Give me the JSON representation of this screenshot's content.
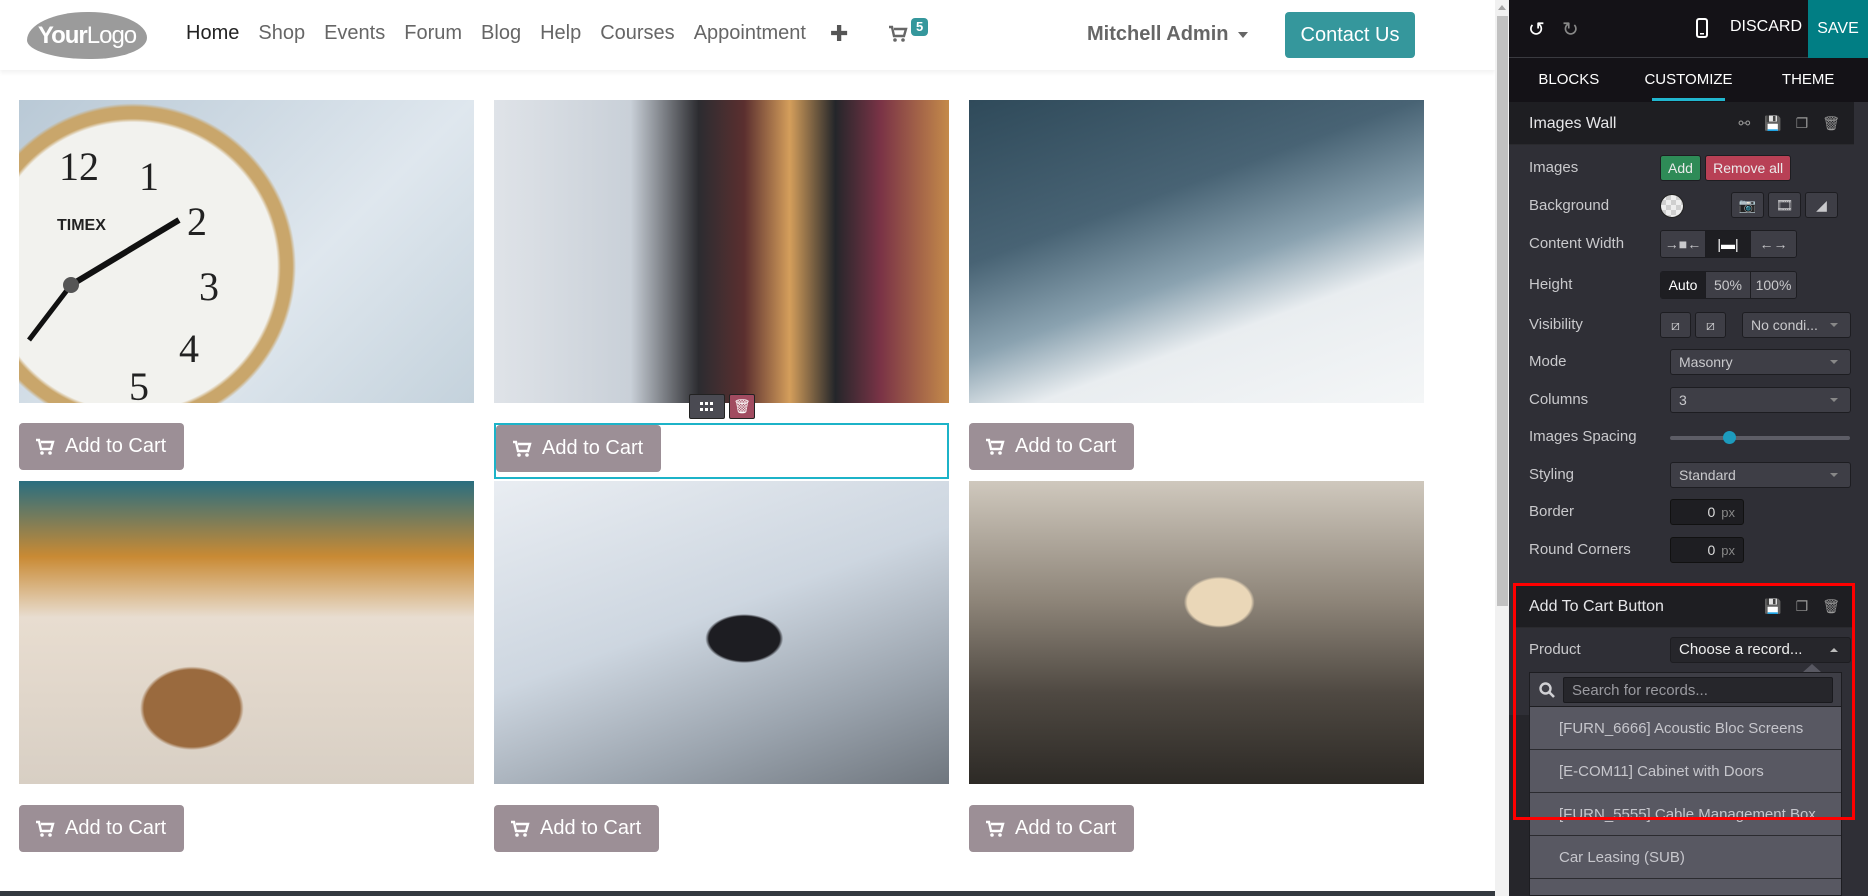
{
  "header": {
    "logo": {
      "bold": "Your",
      "light": "Logo"
    },
    "nav": [
      {
        "label": "Home",
        "active": true
      },
      {
        "label": "Shop"
      },
      {
        "label": "Events"
      },
      {
        "label": "Forum"
      },
      {
        "label": "Blog"
      },
      {
        "label": "Help"
      },
      {
        "label": "Courses"
      },
      {
        "label": "Appointment"
      }
    ],
    "add_icon": "plus-icon",
    "cart_count": "5",
    "user_name": "Mitchell Admin",
    "contact_label": "Contact Us"
  },
  "gallery": {
    "items": [
      {
        "image": "alarm-clock",
        "button": "Add to Cart"
      },
      {
        "image": "clothes-rack",
        "button": "Add to Cart",
        "selected": true
      },
      {
        "image": "man-writing",
        "button": "Add to Cart"
      },
      {
        "image": "iced-coffee",
        "button": "Add to Cart"
      },
      {
        "image": "boat-compass",
        "button": "Add to Cart"
      },
      {
        "image": "wine-glass",
        "button": "Add to Cart"
      }
    ]
  },
  "editor": {
    "discard_label": "DISCARD",
    "save_label": "SAVE",
    "tabs": [
      "BLOCKS",
      "CUSTOMIZE",
      "THEME"
    ],
    "active_tab": "CUSTOMIZE",
    "images_wall": {
      "title": "Images Wall",
      "images_label": "Images",
      "add_label": "Add",
      "remove_all_label": "Remove all",
      "background_label": "Background",
      "content_width_label": "Content Width",
      "height_label": "Height",
      "height_options": [
        "Auto",
        "50%",
        "100%"
      ],
      "height_selected": "Auto",
      "visibility_label": "Visibility",
      "visibility_value": "No condi...",
      "mode_label": "Mode",
      "mode_value": "Masonry",
      "columns_label": "Columns",
      "columns_value": "3",
      "spacing_label": "Images Spacing",
      "spacing_fraction": 0.33,
      "styling_label": "Styling",
      "styling_value": "Standard",
      "border_label": "Border",
      "border_value": "0",
      "round_label": "Round Corners",
      "round_value": "0",
      "unit": "px"
    },
    "add_to_cart": {
      "title": "Add To Cart Button",
      "product_label": "Product",
      "product_value": "Choose a record...",
      "search_placeholder": "Search for records...",
      "options": [
        "[FURN_6666] Acoustic Bloc Screens",
        "[E-COM11] Cabinet with Doors",
        "[FURN_5555] Cable Management Box",
        "Car Leasing (SUB)"
      ]
    }
  }
}
